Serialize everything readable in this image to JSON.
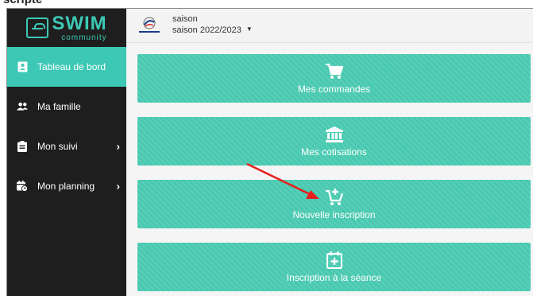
{
  "top_crop_text": "scripte",
  "brand": {
    "name": "SWIM",
    "sub": "community",
    "color": "#3cc8b4"
  },
  "sidebar": {
    "items": [
      {
        "label": "Tableau de bord",
        "icon": "id-card-icon",
        "active": true
      },
      {
        "label": "Ma famille",
        "icon": "users-icon"
      },
      {
        "label": "Mon suivi",
        "icon": "clipboard-icon",
        "has_submenu": true
      },
      {
        "label": "Mon planning",
        "icon": "calendar-clock-icon",
        "has_submenu": true
      }
    ]
  },
  "header": {
    "season_label": "saison",
    "season_value": "saison 2022/2023",
    "club_logo": "club-logo-icon"
  },
  "tiles": [
    {
      "label": "Mes commandes",
      "icon": "cart-icon"
    },
    {
      "label": "Mes cotisations",
      "icon": "bank-icon"
    },
    {
      "label": "Nouvelle inscription",
      "icon": "cart-plus-icon"
    },
    {
      "label": "Inscription à la séance",
      "icon": "calendar-plus-icon"
    }
  ],
  "annotation": {
    "arrow_color": "#e8201e"
  },
  "colors": {
    "accent": "#3cc8b4",
    "tile": "#48c9b0",
    "sidebar": "#1e1e1e"
  }
}
